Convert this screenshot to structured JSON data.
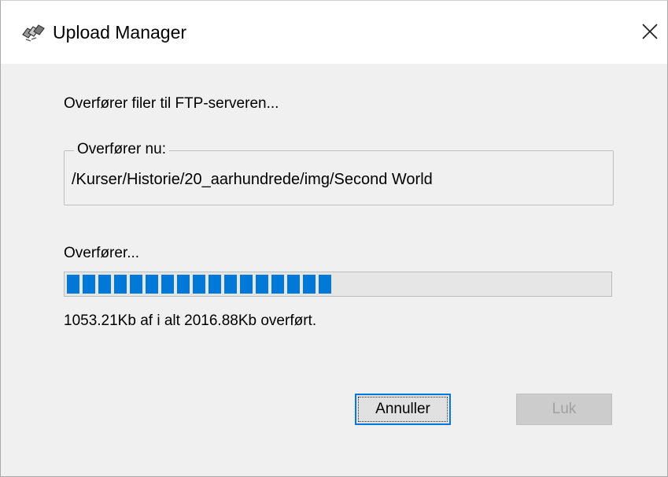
{
  "window": {
    "title": "Upload Manager",
    "icon": "upload-manager-app-icon"
  },
  "titlebar": {
    "close_glyph": "✕"
  },
  "dialog": {
    "message": "Overfører filer til FTP-serveren...",
    "current_group": {
      "legend": "Overfører nu:",
      "path": "/Kurser/Historie/20_aarhundrede/img/Second World"
    },
    "progress_label": "Overfører...",
    "progress": {
      "transferred_kb": 1053.21,
      "total_kb": 2016.88,
      "fraction": 0.522
    },
    "progress_text": "1053.21Kb af i alt 2016.88Kb overført."
  },
  "buttons": {
    "cancel_label": "Annuller",
    "close_label": "Luk",
    "close_enabled": false
  },
  "colors": {
    "accent": "#0078d7",
    "dialog_bg": "#f0f0f0",
    "titlebar_bg": "#ffffff",
    "disabled_text": "#a0a0a0"
  }
}
